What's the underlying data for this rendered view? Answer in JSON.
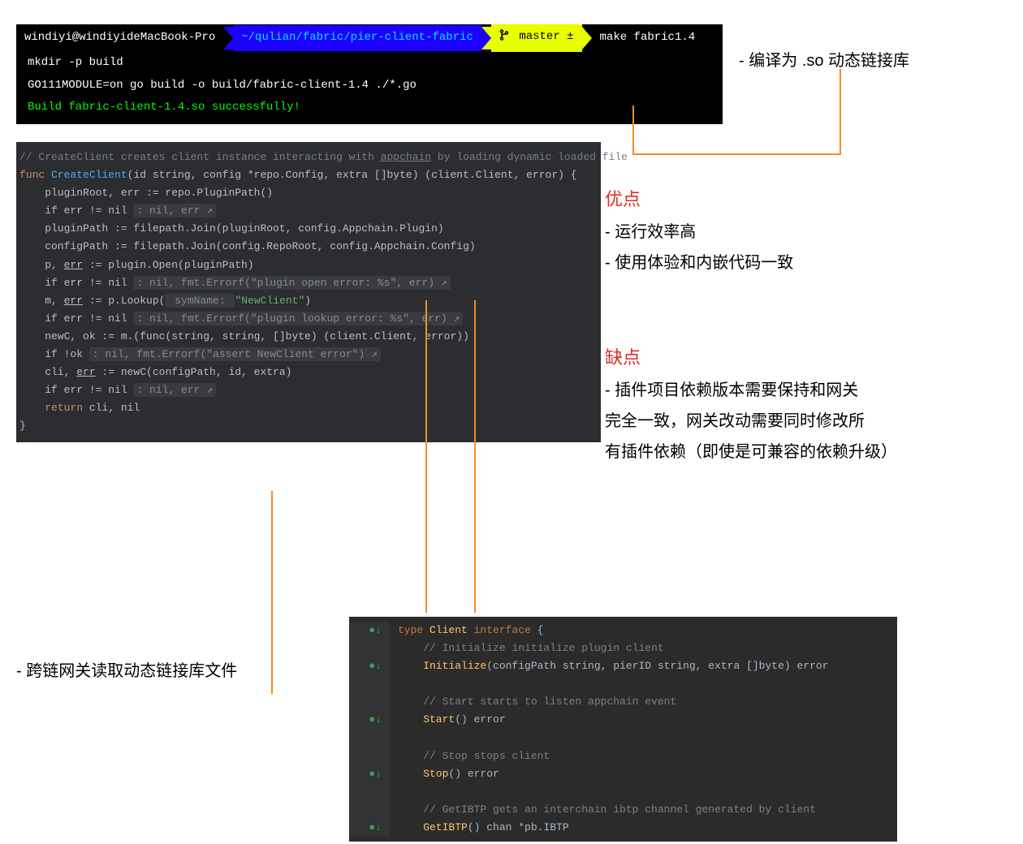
{
  "terminal": {
    "host": " windiyi@windiyideMacBook-Pro ",
    "path": " ~/qulian/fabric/pier-client-fabric ",
    "git": "master ±",
    "cmd": " make fabric1.4 ",
    "line1": "mkdir -p build",
    "line2": "GO111MODULE=on go build -o build/fabric-client-1.4 ./*.go",
    "success": "Build fabric-client-1.4.so successfully!"
  },
  "anno1": "- 编译为 .so 动态链接库",
  "editor1": {
    "l1_a": "// CreateClient creates client instance interacting with ",
    "l1_b": "appchain",
    "l1_c": " by loading dynamic loaded file",
    "l2_func": "func ",
    "l2_name": "CreateClient",
    "l2_sig": "(id string, config *repo.Config, extra []byte) (client.Client, error) {",
    "l3": "    pluginRoot, err := repo.PluginPath()",
    "l4_a": "    if err != nil ",
    "l4_hint": ": nil, err ↗",
    "l5": "    pluginPath := filepath.Join(pluginRoot, config.Appchain.Plugin)",
    "l6": "    configPath := filepath.Join(config.RepoRoot, config.Appchain.Config)",
    "l7": "",
    "l8_a": "    p, ",
    "l8_err": "err",
    "l8_b": " := plugin.Open(pluginPath)",
    "l9_a": "    if err != nil ",
    "l9_hint": ": nil, fmt.Errorf(\"plugin open error: %s\", err) ↗",
    "l10": "",
    "l11_a": "    m, ",
    "l11_err": "err",
    "l11_b": " := p.Lookup(",
    "l11_hint": " symName: ",
    "l11_str": "\"NewClient\"",
    "l11_c": ")",
    "l12_a": "    if err != nil ",
    "l12_hint": ": nil, fmt.Errorf(\"plugin lookup error: %s\", err) ↗",
    "l13": "",
    "l14": "    newC, ok := m.(func(string, string, []byte) (client.Client, error))",
    "l15_a": "    if !ok ",
    "l15_hint": ": nil, fmt.Errorf(\"assert NewClient error\") ↗",
    "l16": "",
    "l17_a": "    cli, ",
    "l17_err": "err",
    "l17_b": " := newC(configPath, id, extra)",
    "l18_a": "    if err != nil ",
    "l18_hint": ": nil, err ↗",
    "l19": "",
    "l20_a": "    return ",
    "l20_b": "cli, nil",
    "l21": "}"
  },
  "pros": {
    "heading": "优点",
    "b1": "- 运行效率高",
    "b2": "- 使用体验和内嵌代码一致"
  },
  "cons": {
    "heading": "缺点",
    "b1": "- 插件项目依赖版本需要保持和网关",
    "b2": "完全一致，网关改动需要同时修改所",
    "b3": "有插件依赖（即使是可兼容的依赖升级）"
  },
  "anno2": "- 跨链网关读取动态链接库文件",
  "editor2": {
    "l1_kw": "type ",
    "l1_id": "Client ",
    "l1_kw2": "interface ",
    "l1_br": "{",
    "l2": "    // Initialize initialize plugin client",
    "l3_id": "    Initialize",
    "l3_sig": "(configPath string, pierID string, extra []byte) error",
    "l4": "",
    "l5": "    // Start starts to listen appchain event",
    "l6_id": "    Start",
    "l6_sig": "() error",
    "l7": "",
    "l8": "    // Stop stops client",
    "l9_id": "    Stop",
    "l9_sig": "() error",
    "l10": "",
    "l11": "    // GetIBTP gets an interchain ibtp channel generated by client",
    "l12_id": "    GetIBTP",
    "l12_sig": "() chan *pb.IBTP"
  }
}
